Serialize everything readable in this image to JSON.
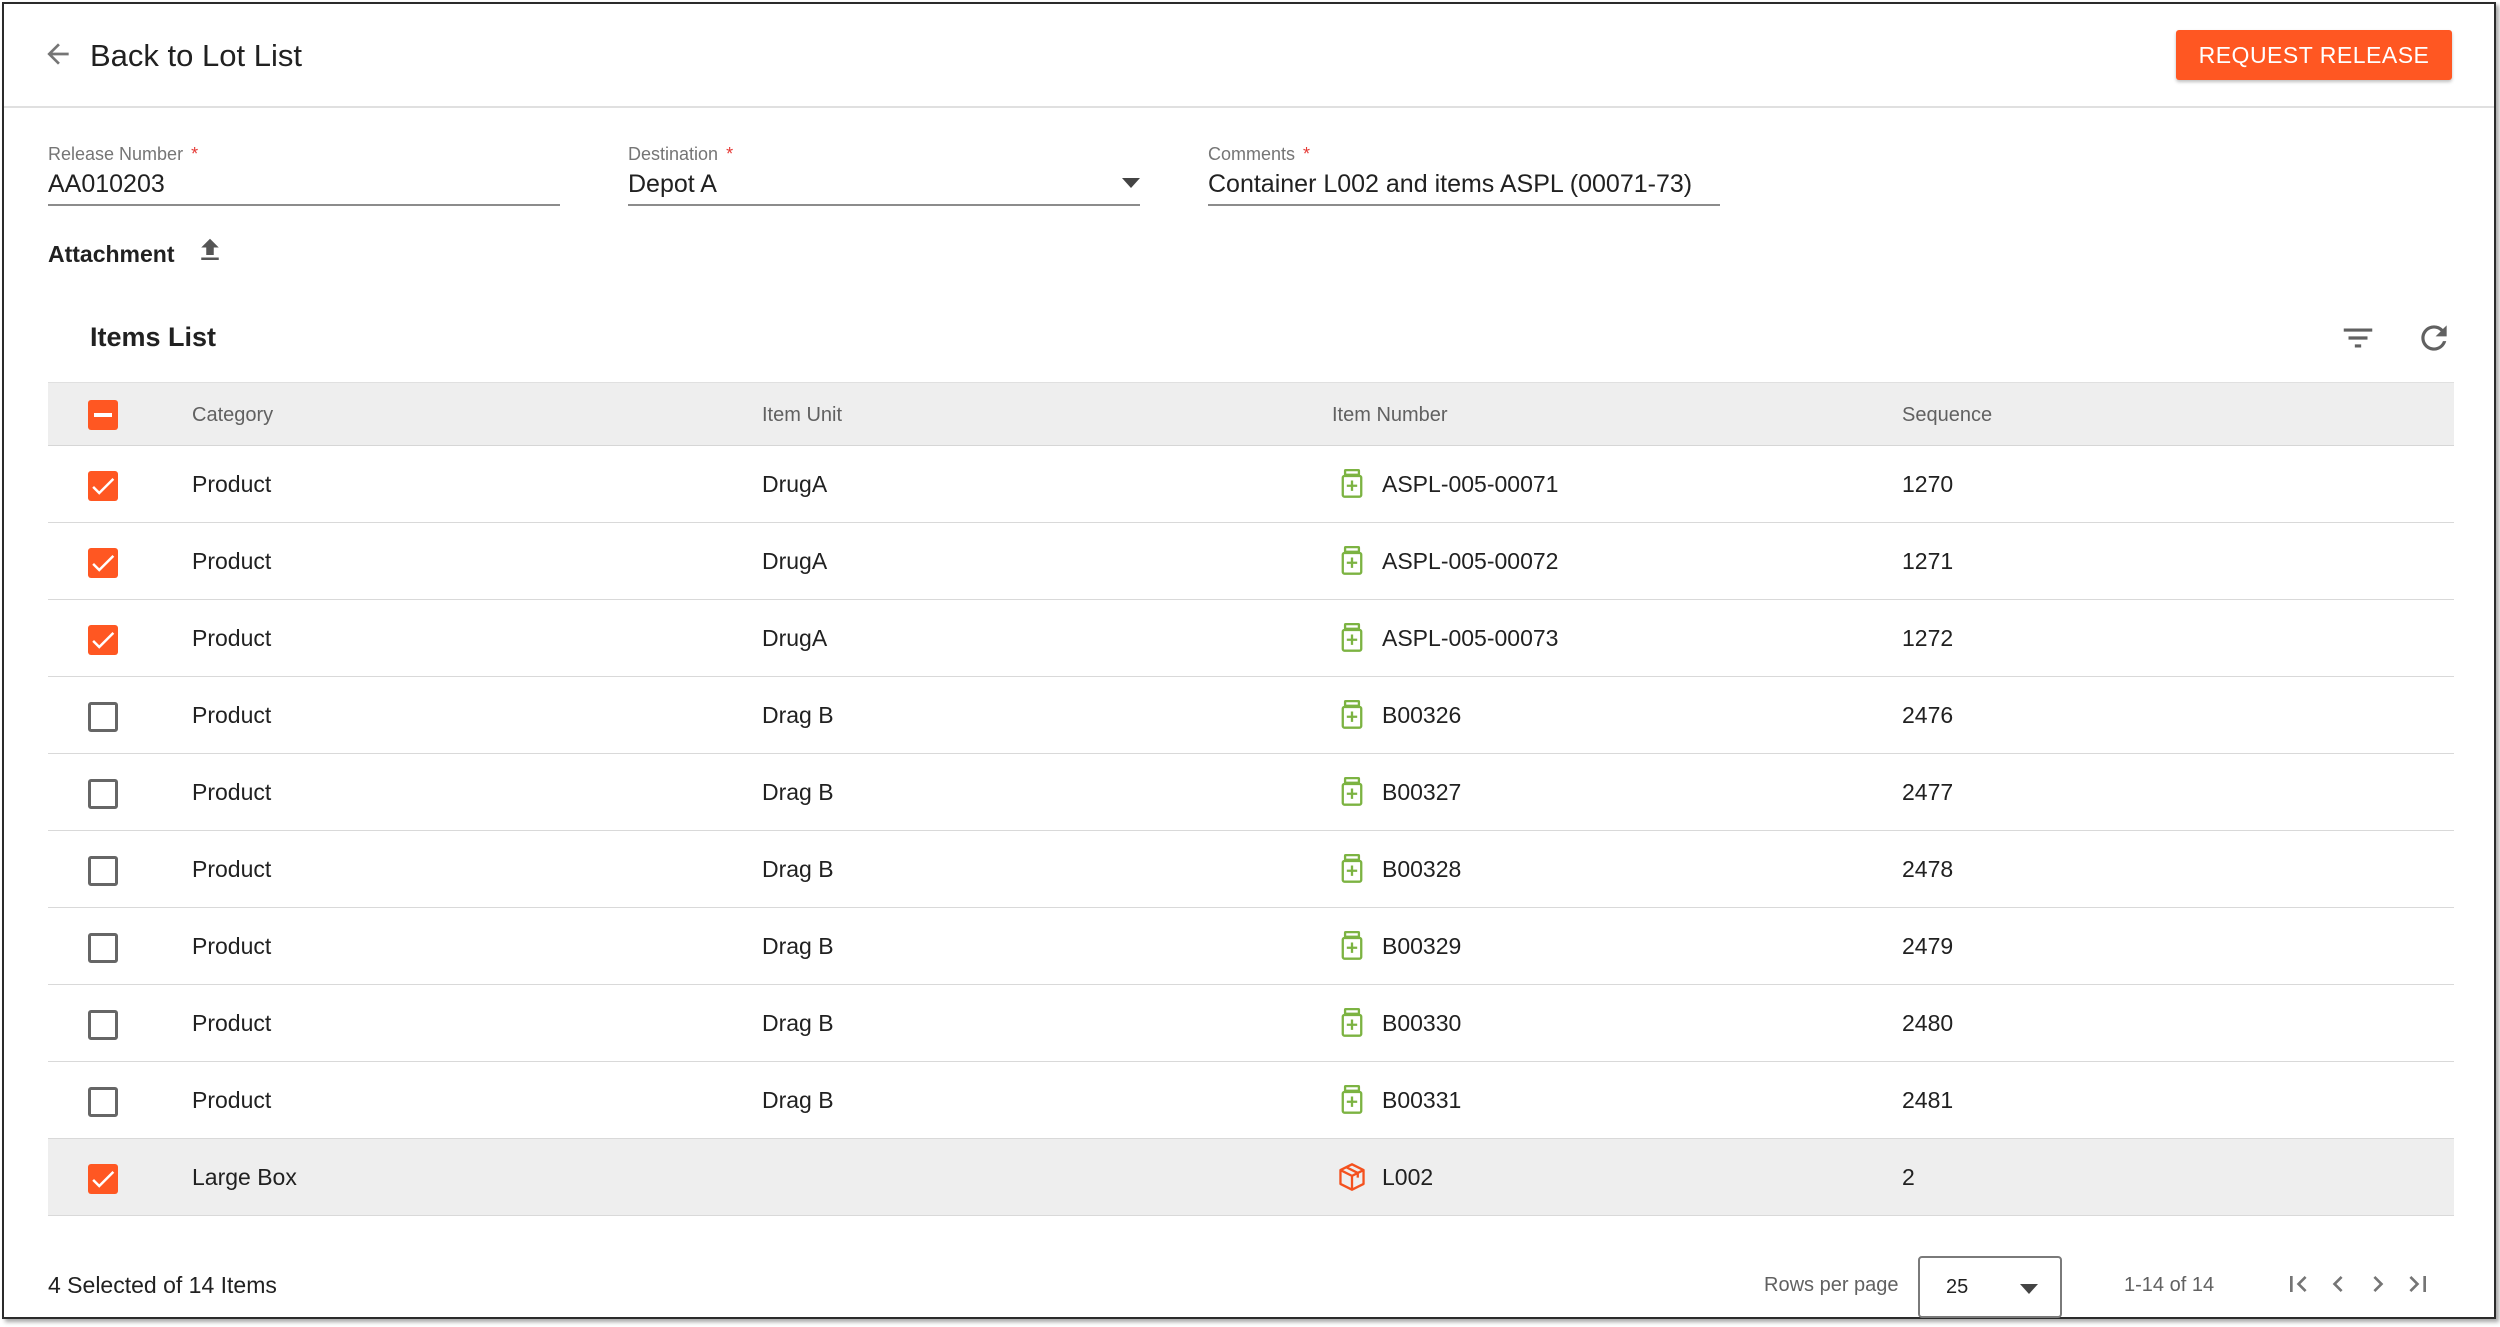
{
  "header": {
    "back_label": "Back to Lot List",
    "request_button": "REQUEST RELEASE"
  },
  "form": {
    "release_number": {
      "label": "Release Number",
      "value": "AA010203",
      "required_mark": "*"
    },
    "destination": {
      "label": "Destination",
      "value": "Depot A",
      "required_mark": "*"
    },
    "comments": {
      "label": "Comments",
      "value": "Container L002 and items ASPL (00071-73)",
      "required_mark": "*"
    },
    "attachment_label": "Attachment"
  },
  "items_list": {
    "title": "Items List",
    "columns": [
      "Category",
      "Item Unit",
      "Item Number",
      "Sequence"
    ],
    "rows": [
      {
        "category": "Product",
        "item_unit": "DrugA",
        "item_number": "ASPL-005-00071",
        "sequence": "1270",
        "checked": true,
        "icon": "medicine-bottle-icon"
      },
      {
        "category": "Product",
        "item_unit": "DrugA",
        "item_number": "ASPL-005-00072",
        "sequence": "1271",
        "checked": true,
        "icon": "medicine-bottle-icon"
      },
      {
        "category": "Product",
        "item_unit": "DrugA",
        "item_number": "ASPL-005-00073",
        "sequence": "1272",
        "checked": true,
        "icon": "medicine-bottle-icon"
      },
      {
        "category": "Product",
        "item_unit": "Drag B",
        "item_number": "B00326",
        "sequence": "2476",
        "checked": false,
        "icon": "medicine-bottle-icon"
      },
      {
        "category": "Product",
        "item_unit": "Drag B",
        "item_number": "B00327",
        "sequence": "2477",
        "checked": false,
        "icon": "medicine-bottle-icon"
      },
      {
        "category": "Product",
        "item_unit": "Drag B",
        "item_number": "B00328",
        "sequence": "2478",
        "checked": false,
        "icon": "medicine-bottle-icon"
      },
      {
        "category": "Product",
        "item_unit": "Drag B",
        "item_number": "B00329",
        "sequence": "2479",
        "checked": false,
        "icon": "medicine-bottle-icon"
      },
      {
        "category": "Product",
        "item_unit": "Drag B",
        "item_number": "B00330",
        "sequence": "2480",
        "checked": false,
        "icon": "medicine-bottle-icon"
      },
      {
        "category": "Product",
        "item_unit": "Drag B",
        "item_number": "B00331",
        "sequence": "2481",
        "checked": false,
        "icon": "medicine-bottle-icon"
      },
      {
        "category": "Large Box",
        "item_unit": "",
        "item_number": "L002",
        "sequence": "2",
        "checked": true,
        "icon": "box-icon"
      }
    ]
  },
  "footer": {
    "selected_summary": "4 Selected of 14 Items",
    "rows_per_page_label": "Rows per page",
    "rows_per_page_value": "25",
    "range": "1-14 of 14"
  },
  "colors": {
    "accent": "#ff5722",
    "product_icon": "#7cb342",
    "box_icon": "#f4511e"
  }
}
